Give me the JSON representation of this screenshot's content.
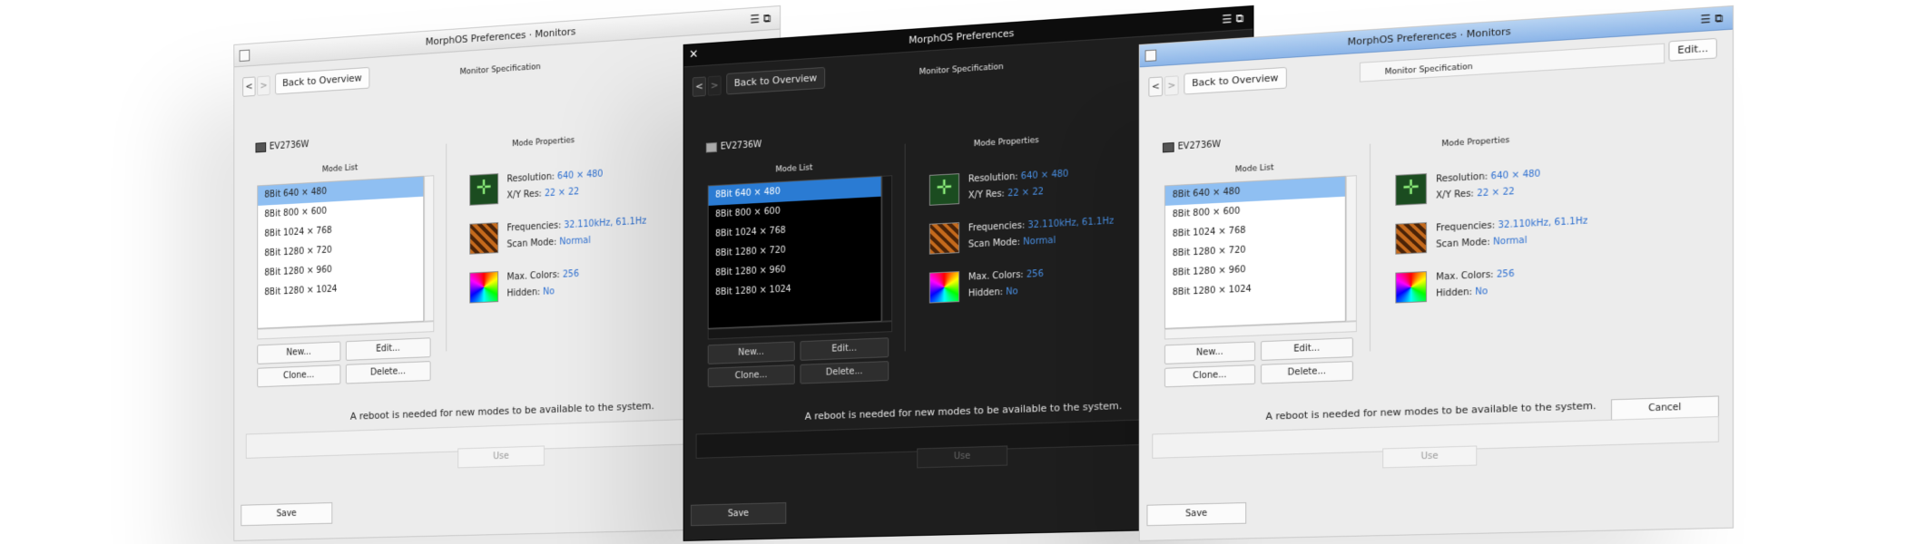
{
  "windows": [
    {
      "title": "MorphOS Preferences · Monitors",
      "back_label": "Back to Overview",
      "monitor_spec_label": "Monitor Specification",
      "monitor_name": "EV2736W",
      "mode_list_label": "Mode List",
      "modes": [
        "8Bit  640 × 480",
        "8Bit  800 ×  600",
        "8Bit  1024 × 768",
        "8Bit  1280 × 720",
        "8Bit  1280 × 960",
        "8Bit  1280 × 1024"
      ],
      "mode_properties_label": "Mode Properties",
      "resolution_label": "Resolution:",
      "resolution_value": "640 × 480",
      "xy_res_label": "X/Y Res:",
      "xy_res_value": "22 × 22",
      "frequencies_label": "Frequencies:",
      "frequencies_value": "32.110kHz, 61.1Hz",
      "scan_mode_label": "Scan Mode:",
      "scan_mode_value": "Normal",
      "max_colors_label": "Max. Colors:",
      "max_colors_value": "256",
      "hidden_label": "Hidden:",
      "hidden_value": "No",
      "new_label": "New...",
      "edit_label": "Edit...",
      "clone_label": "Clone...",
      "delete_label": "Delete...",
      "notice": "A reboot is needed for new modes to be available to the system.",
      "use_label": "Use",
      "save_label": "Save"
    },
    {
      "title": "MorphOS Preferences",
      "back_label": "Back to Overview",
      "monitor_spec_label": "Monitor Specification",
      "monitor_name": "EV2736W",
      "mode_list_label": "Mode List",
      "modes": [
        "8Bit  640 × 480",
        "8Bit  800 ×  600",
        "8Bit  1024 × 768",
        "8Bit  1280 × 720",
        "8Bit  1280 × 960",
        "8Bit  1280 × 1024"
      ],
      "mode_properties_label": "Mode Properties",
      "resolution_label": "Resolution:",
      "resolution_value": "640 × 480",
      "xy_res_label": "X/Y Res:",
      "xy_res_value": "22 × 22",
      "frequencies_label": "Frequencies:",
      "frequencies_value": "32.110kHz, 61.1Hz",
      "scan_mode_label": "Scan Mode:",
      "scan_mode_value": "Normal",
      "max_colors_label": "Max. Colors:",
      "max_colors_value": "256",
      "hidden_label": "Hidden:",
      "hidden_value": "No",
      "new_label": "New...",
      "edit_label": "Edit...",
      "clone_label": "Clone...",
      "delete_label": "Delete...",
      "notice": "A reboot is needed for new modes to be available to the system.",
      "use_label": "Use",
      "save_label": "Save"
    },
    {
      "title": "MorphOS Preferences · Monitors",
      "back_label": "Back to Overview",
      "monitor_spec_label": "Monitor Specification",
      "edit_top_label": "Edit...",
      "monitor_name": "EV2736W",
      "mode_list_label": "Mode List",
      "modes": [
        "8Bit  640 × 480",
        "8Bit  800 ×  600",
        "8Bit  1024 × 768",
        "8Bit  1280 × 720",
        "8Bit  1280 × 960",
        "8Bit  1280 × 1024"
      ],
      "mode_properties_label": "Mode Properties",
      "resolution_label": "Resolution:",
      "resolution_value": "640 × 480",
      "xy_res_label": "X/Y Res:",
      "xy_res_value": "22 × 22",
      "frequencies_label": "Frequencies:",
      "frequencies_value": "32.110kHz, 61.1Hz",
      "scan_mode_label": "Scan Mode:",
      "scan_mode_value": "Normal",
      "max_colors_label": "Max. Colors:",
      "max_colors_value": "256",
      "hidden_label": "Hidden:",
      "hidden_value": "No",
      "new_label": "New...",
      "edit_label": "Edit...",
      "clone_label": "Clone...",
      "delete_label": "Delete...",
      "notice": "A reboot is needed for new modes to be available to the system.",
      "use_label": "Use",
      "save_label": "Save",
      "cancel_label": "Cancel"
    }
  ],
  "theme": {
    "accent_light": "#8fbff2",
    "accent_dark": "#2a7bd3",
    "value_color": "#2d6fd0",
    "active_titlebar": "#8cb5e8"
  },
  "icons": {
    "resolution": "move-arrows-icon",
    "frequency": "checker-pattern-icon",
    "colors": "color-wheel-icon",
    "monitor": "monitor-icon"
  }
}
